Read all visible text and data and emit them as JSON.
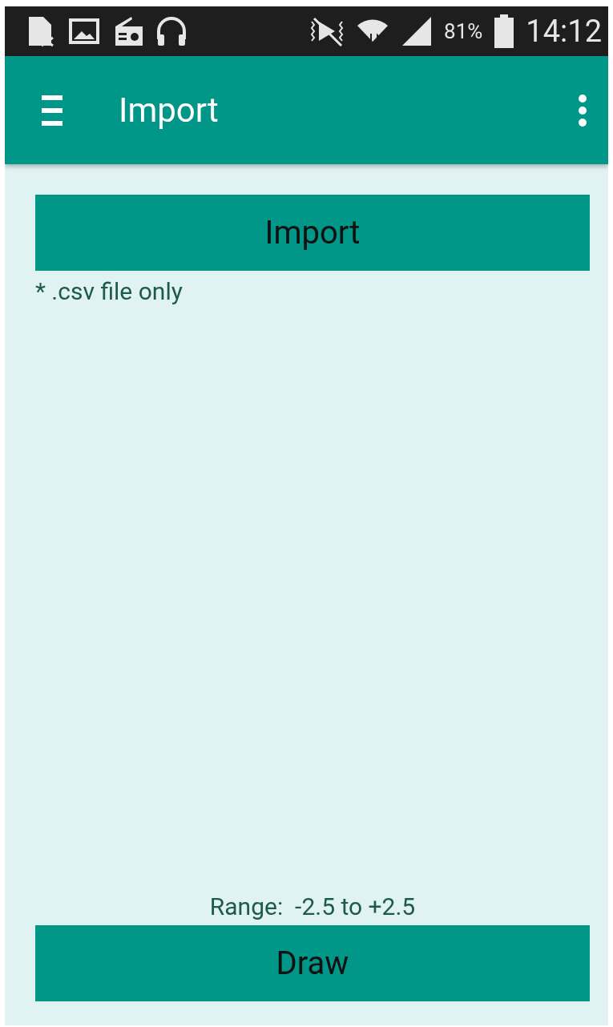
{
  "status_bar": {
    "battery_text": "81%",
    "time": "14:12"
  },
  "app_bar": {
    "title": "Import"
  },
  "import_button": {
    "label": "Import"
  },
  "note": "* .csv file only",
  "range_text": "Range:  -2.5 to +2.5",
  "draw_button": {
    "label": "Draw"
  }
}
